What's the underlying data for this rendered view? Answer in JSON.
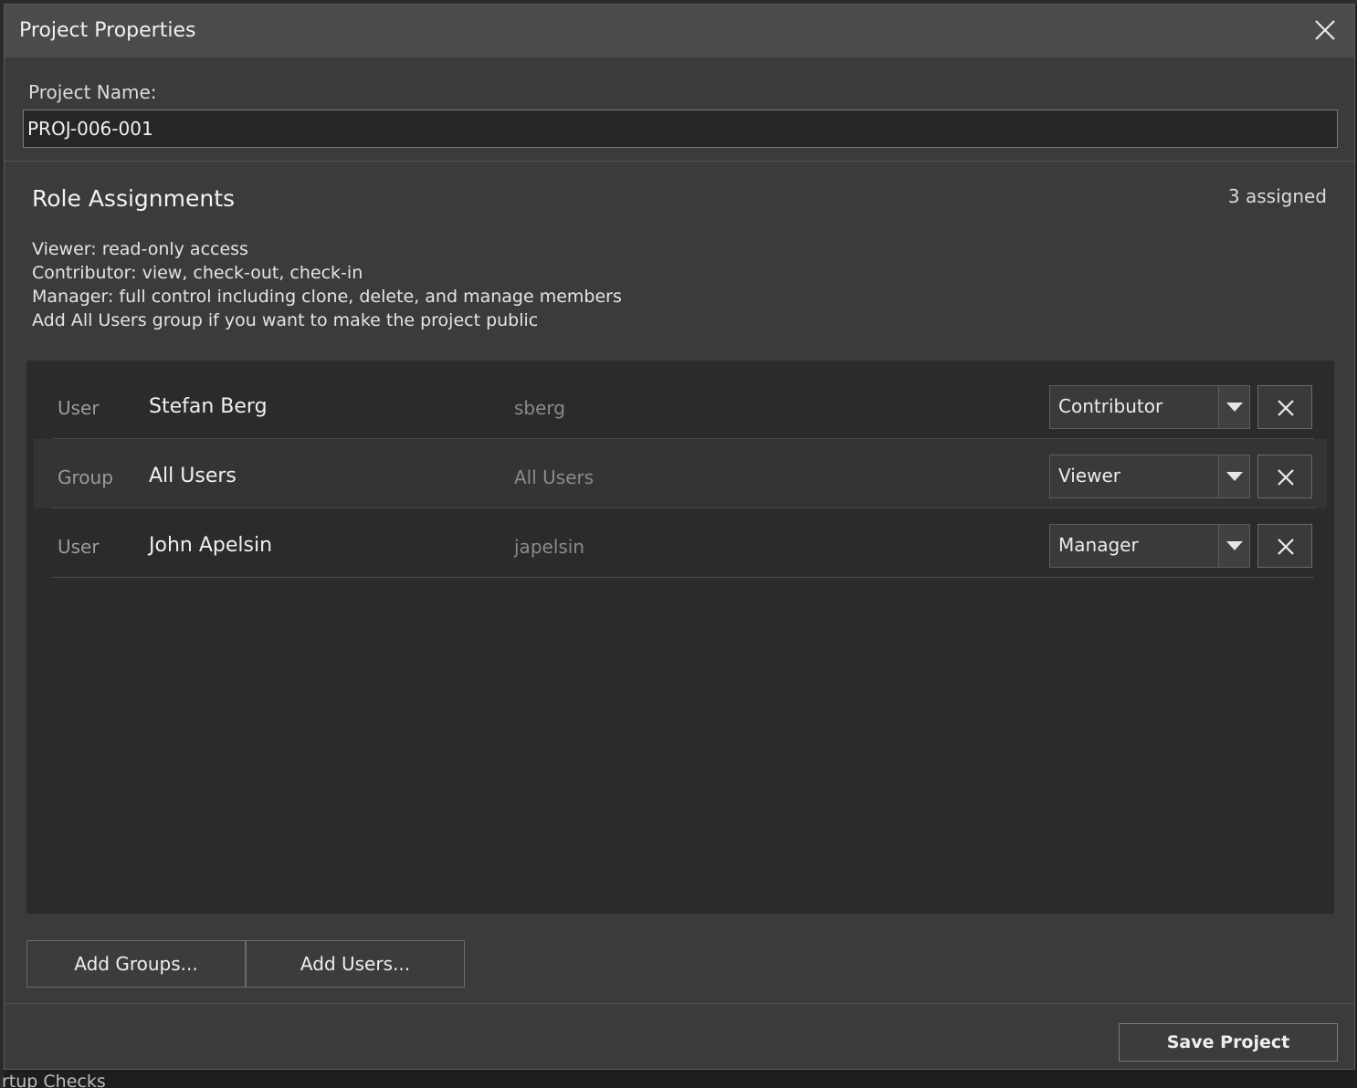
{
  "dialog": {
    "title": "Project Properties"
  },
  "project": {
    "name_label": "Project Name:",
    "name_value": "PROJ-006-001"
  },
  "roles": {
    "section_title": "Role Assignments",
    "assigned_count": "3 assigned",
    "help_lines": [
      "Viewer: read-only access",
      "Contributor: view, check-out, check-in",
      "Manager: full control including clone, delete, and manage members",
      "Add All Users group if you want to make the project public"
    ],
    "rows": [
      {
        "kind": "User",
        "display": "Stefan Berg",
        "login": "sberg",
        "role": "Contributor"
      },
      {
        "kind": "Group",
        "display": "All Users",
        "login": "All Users",
        "role": "Viewer"
      },
      {
        "kind": "User",
        "display": "John Apelsin",
        "login": "japelsin",
        "role": "Manager"
      }
    ]
  },
  "buttons": {
    "add_groups": "Add Groups...",
    "add_users": "Add Users...",
    "save": "Save Project"
  },
  "background": {
    "partial_text": "rtup Checks"
  },
  "icons": {
    "close": "close-icon",
    "dropdown": "chevron-down-icon",
    "remove": "remove-icon"
  }
}
